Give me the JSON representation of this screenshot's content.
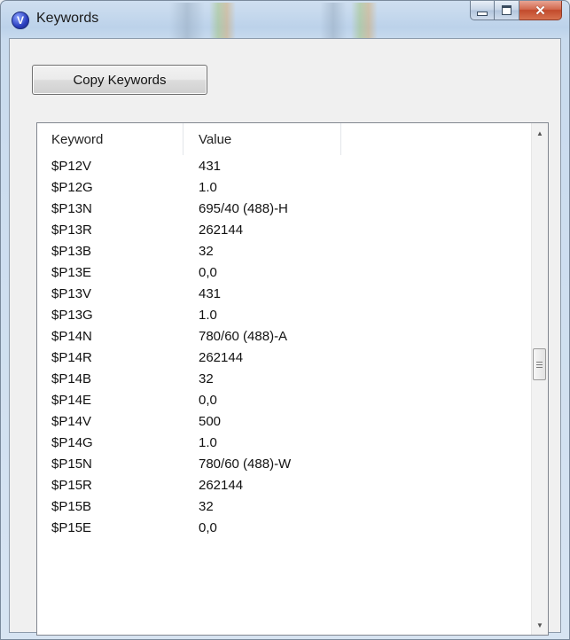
{
  "window": {
    "title": "Keywords",
    "app_icon": "V"
  },
  "toolbar": {
    "copy_label": "Copy Keywords"
  },
  "table": {
    "columns": [
      "Keyword",
      "Value",
      ""
    ],
    "rows": [
      {
        "keyword": "$P12V",
        "value": "431"
      },
      {
        "keyword": "$P12G",
        "value": "1.0"
      },
      {
        "keyword": "$P13N",
        "value": "695/40 (488)-H"
      },
      {
        "keyword": "$P13R",
        "value": "262144"
      },
      {
        "keyword": "$P13B",
        "value": "32"
      },
      {
        "keyword": "$P13E",
        "value": "0,0"
      },
      {
        "keyword": "$P13V",
        "value": "431"
      },
      {
        "keyword": "$P13G",
        "value": "1.0"
      },
      {
        "keyword": "$P14N",
        "value": "780/60 (488)-A"
      },
      {
        "keyword": "$P14R",
        "value": "262144"
      },
      {
        "keyword": "$P14B",
        "value": "32"
      },
      {
        "keyword": "$P14E",
        "value": "0,0"
      },
      {
        "keyword": "$P14V",
        "value": "500"
      },
      {
        "keyword": "$P14G",
        "value": "1.0"
      },
      {
        "keyword": "$P15N",
        "value": "780/60 (488)-W"
      },
      {
        "keyword": "$P15R",
        "value": "262144"
      },
      {
        "keyword": "$P15B",
        "value": "32"
      },
      {
        "keyword": "$P15E",
        "value": "0,0"
      }
    ]
  },
  "icons": {
    "scroll_up": "scroll-up-arrow-icon",
    "scroll_down": "scroll-down-arrow-icon",
    "minimize": "minimize-icon",
    "maximize": "maximize-icon",
    "close": "close-icon"
  },
  "colors": {
    "close_button": "#c24a2c",
    "app_icon": "#2b3fbf"
  }
}
